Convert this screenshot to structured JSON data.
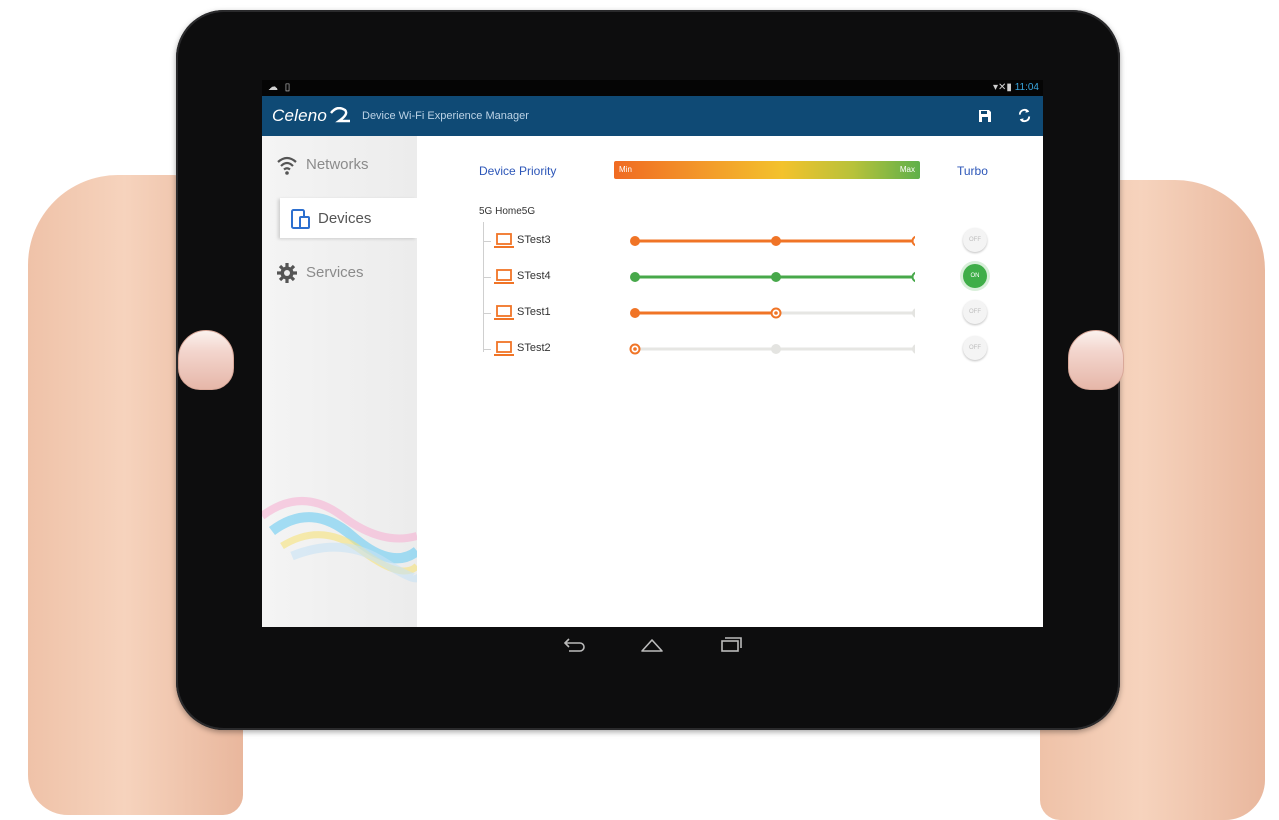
{
  "status_bar": {
    "time": "11:04",
    "left_icons": "cloud-icon sim-icon",
    "right_icons": "wifi-icon signal-icon battery-icon"
  },
  "app_bar": {
    "logo": "Celeno",
    "title": "Device Wi-Fi Experience Manager",
    "icons": [
      "save-icon",
      "refresh-icon"
    ],
    "color": "#0f4a75"
  },
  "sidebar": {
    "items": [
      {
        "label": "Networks",
        "icon": "wifi-icon",
        "active": false
      },
      {
        "label": "Devices",
        "icon": "devices-icon",
        "active": true
      },
      {
        "label": "Services",
        "icon": "gear-icon",
        "active": false
      }
    ]
  },
  "header": {
    "priority_label": "Device Priority",
    "bar_min": "Min",
    "bar_max": "Max",
    "turbo_label": "Turbo"
  },
  "network": {
    "name": "5G Home5G"
  },
  "devices": [
    {
      "name": "STest3",
      "priority_level": 2,
      "level_of": 2,
      "turbo": "OFF",
      "turbo_on": false,
      "color": "#f07426"
    },
    {
      "name": "STest4",
      "priority_level": 2,
      "level_of": 2,
      "turbo": "ON",
      "turbo_on": true,
      "color": "#47a84a"
    },
    {
      "name": "STest1",
      "priority_level": 1,
      "level_of": 2,
      "turbo": "OFF",
      "turbo_on": false,
      "color": "#f07426"
    },
    {
      "name": "STest2",
      "priority_level": 0,
      "level_of": 2,
      "turbo": "OFF",
      "turbo_on": false,
      "color": "#f07426"
    }
  ],
  "nav_bar": {
    "icons": [
      "back-icon",
      "home-icon",
      "recents-icon"
    ]
  }
}
